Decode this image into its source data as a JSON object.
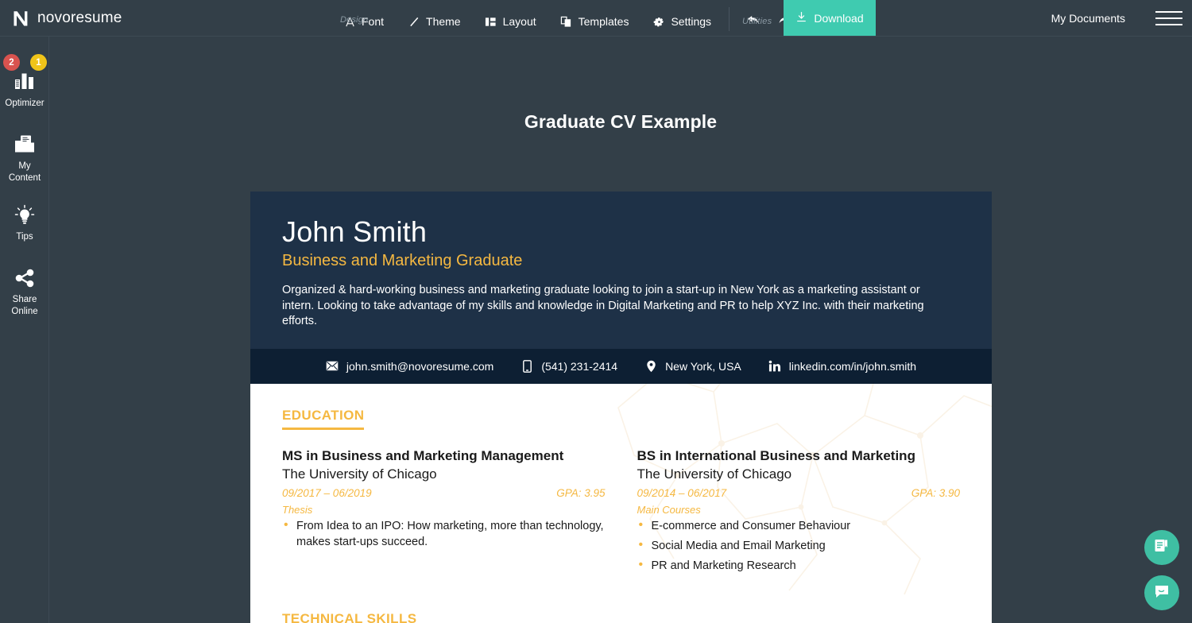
{
  "brand": {
    "name": "novoresume",
    "logo_icon": "novoresume-n-logo"
  },
  "topnav": {
    "design_group_label": "Design",
    "utilities_group_label": "Utilities",
    "design_items": [
      {
        "label": "Font",
        "icon": "letter-a-icon"
      },
      {
        "label": "Theme",
        "icon": "brush-stroke-icon"
      },
      {
        "label": "Layout",
        "icon": "layout-columns-icon"
      },
      {
        "label": "Templates",
        "icon": "stacked-pages-icon"
      },
      {
        "label": "Settings",
        "icon": "gear-icon"
      }
    ],
    "utilities": [
      {
        "name": "undo",
        "icon": "undo-arrow-icon"
      },
      {
        "name": "redo",
        "icon": "redo-arrow-icon"
      }
    ],
    "download_label": "Download",
    "download_icon": "download-icon",
    "download_color": "#3fcbb0",
    "my_documents_label": "My Documents",
    "menu_icon": "hamburger-menu-icon"
  },
  "sidebar": {
    "items": [
      {
        "label": "Optimizer",
        "icon": "bar-chart-icon",
        "badges": [
          {
            "value": "2",
            "color": "#d9534f"
          },
          {
            "value": "1",
            "color": "#f0c419"
          }
        ]
      },
      {
        "label": "My\nContent",
        "icon": "folder-document-icon",
        "badges": []
      },
      {
        "label": "Tips",
        "icon": "lightbulb-icon",
        "badges": []
      },
      {
        "label": "Share\nOnline",
        "icon": "share-nodes-icon",
        "badges": []
      }
    ]
  },
  "document": {
    "title": "Graduate CV Example"
  },
  "resume": {
    "name": "John Smith",
    "role": "Business and Marketing Graduate",
    "summary": "Organized & hard-working business and marketing graduate looking to join a start-up in New York as a marketing assistant or intern. Looking to take advantage of my skills and knowledge in Digital Marketing and PR to help XYZ Inc. with their marketing efforts.",
    "accent_color": "#f5b841",
    "header_bg": "#1e3147",
    "contact_bg": "#0d1f33",
    "contact": [
      {
        "icon": "envelope-icon",
        "value": "john.smith@novoresume.com"
      },
      {
        "icon": "phone-icon",
        "value": "(541) 231-2414"
      },
      {
        "icon": "location-pin-icon",
        "value": "New York, USA"
      },
      {
        "icon": "linkedin-icon",
        "value": "linkedin.com/in/john.smith"
      }
    ],
    "sections": {
      "education_title": "EDUCATION",
      "technical_skills_title": "TECHNICAL SKILLS",
      "education": [
        {
          "degree": "MS in Business and Marketing Management",
          "school": "The University of Chicago",
          "dates": "09/2017 – 06/2019",
          "gpa": "GPA: 3.95",
          "subheading": "Thesis",
          "bullets": [
            "From Idea to an IPO: How marketing, more than technology, makes start-ups succeed."
          ]
        },
        {
          "degree": "BS in International Business and Marketing",
          "school": "The University of Chicago",
          "dates": "09/2014 – 06/2017",
          "gpa": "GPA: 3.90",
          "subheading": "Main Courses",
          "bullets": [
            "E-commerce and Consumer Behaviour",
            "Social Media and Email Marketing",
            "PR and Marketing Research"
          ]
        }
      ]
    }
  },
  "floating_buttons": [
    {
      "name": "document-edit",
      "icon": "document-pencil-icon",
      "color": "#3fbfa3"
    },
    {
      "name": "chat-support",
      "icon": "chat-smile-icon",
      "color": "#3fbfa3"
    }
  ]
}
